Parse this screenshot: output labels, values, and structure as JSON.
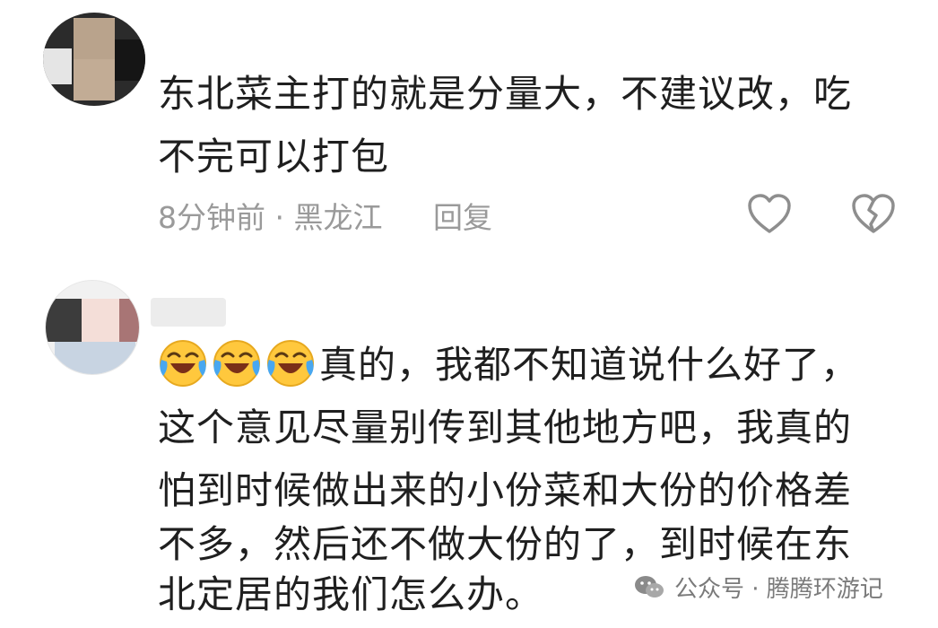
{
  "comment1": {
    "text_lines": [
      "东北菜主打的就是分量大，不建议改，吃",
      "不完可以打包"
    ],
    "time": "8分钟前",
    "separator": " · ",
    "location": "黑龙江",
    "reply_label": "回复",
    "like_icon": "heart-outline-icon",
    "dislike_icon": "broken-heart-icon"
  },
  "comment2": {
    "emoji": [
      "laughing-crying-emoji",
      "laughing-crying-emoji",
      "laughing-crying-emoji"
    ],
    "text_lines": [
      "真的，我都不知道说什么好了，",
      "这个意见尽量别传到其他地方吧，我真的",
      "怕到时候做出来的小份菜和大份的价格差",
      "不多，然后还不做大份的了，到时候在东",
      "北定居的我们怎么办。"
    ]
  },
  "watermark": {
    "icon": "wechat-icon",
    "text": "公众号 · 腾腾环游记"
  }
}
